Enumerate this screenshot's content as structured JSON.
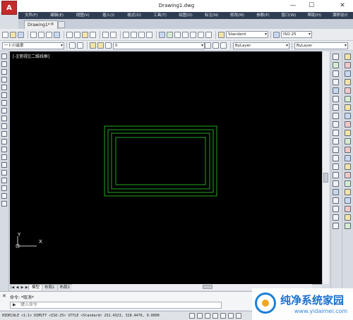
{
  "window": {
    "title": "Drawing1.dwg",
    "logo_letter": "A",
    "minimize": "—",
    "maximize": "☐",
    "close": "✕"
  },
  "menu": [
    "文件(F)",
    "编辑(E)",
    "视图(V)",
    "插入(I)",
    "格式(O)",
    "工具(T)",
    "绘图(D)",
    "标注(N)",
    "修改(M)",
    "参数(P)",
    "窗口(W)",
    "帮助(H)",
    "漂移设计"
  ],
  "tabs": {
    "document_tab": "Drawing1*",
    "close_glyph": "×"
  },
  "toolbar": {
    "text_style": "Standard",
    "dim_style": "ISO-25",
    "layer_selector": "一卜川遥景",
    "layer_value": "0",
    "color_control": "ByLayer",
    "linetype_control": "ByLayer"
  },
  "canvas": {
    "viewport_label": "[-][俯视][二维线框]",
    "background_color": "#000000",
    "line_color": "#2fd12f",
    "ucs_y_label": "Y",
    "ucs_x_label": "X"
  },
  "layout_tabs": {
    "nav": [
      "|◀",
      "◀",
      "▶",
      "▶|"
    ],
    "items": [
      "模型",
      "布局1",
      "布局2"
    ]
  },
  "command": {
    "history_line": "命令: *取消*",
    "input_placeholder": "键入命令",
    "close_glyph": "✕",
    "input_icon": "▶"
  },
  "status": {
    "text": "HIDECALE <1:1> DIMSTY <ISO-25> STYLE <Standard>  252.4323, 328.4476, 0.0000"
  },
  "watermark": {
    "text": "纯净系统家园",
    "url": "www.yidaimei.com"
  }
}
